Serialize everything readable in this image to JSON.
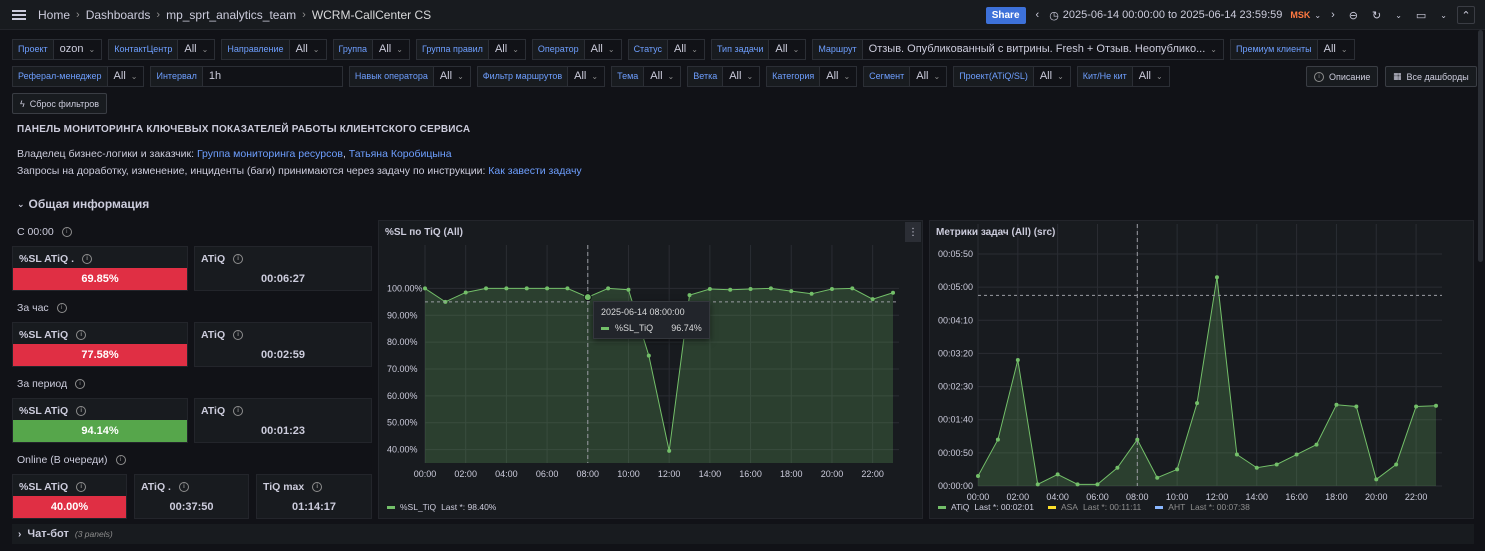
{
  "topbar": {
    "breadcrumb": [
      "Home",
      "Dashboards",
      "mp_sprt_analytics_team",
      "WCRM-CallCenter CS"
    ],
    "share_label": "Share",
    "time_range": "2025-06-14 00:00:00 to 2025-06-14 23:59:59",
    "timezone": "MSK"
  },
  "variables": {
    "row1": [
      {
        "label": "Проект",
        "value": "ozon"
      },
      {
        "label": "КонтактЦентр",
        "value": "All"
      },
      {
        "label": "Направление",
        "value": "All"
      },
      {
        "label": "Группа",
        "value": "All"
      },
      {
        "label": "Группа правил",
        "value": "All"
      },
      {
        "label": "Оператор",
        "value": "All"
      },
      {
        "label": "Статус",
        "value": "All"
      },
      {
        "label": "Тип задачи",
        "value": "All"
      },
      {
        "label": "Маршрут",
        "value": "Отзыв. Опубликованный с витрины. Fresh + Отзыв. Неопублико..."
      },
      {
        "label": "Премиум клиенты",
        "value": "All"
      }
    ],
    "row2": [
      {
        "label": "Реферал-менеджер",
        "value": "All"
      },
      {
        "label": "Интервал",
        "value": "1h"
      },
      {
        "label": "Навык оператора",
        "value": "All"
      },
      {
        "label": "Фильтр маршрутов",
        "value": "All"
      },
      {
        "label": "Тема",
        "value": "All"
      },
      {
        "label": "Ветка",
        "value": "All"
      },
      {
        "label": "Категория",
        "value": "All"
      },
      {
        "label": "Сегмент",
        "value": "All"
      },
      {
        "label": "Проект(ATiQ/SL)",
        "value": "All"
      },
      {
        "label": "Кит/Не кит",
        "value": "All"
      }
    ],
    "description_button": "Описание",
    "all_dashboards_button": "Все дашборды",
    "reset_button": "Сброс фильтров"
  },
  "text": {
    "heading": "ПАНЕЛЬ МОНИТОРИНГА КЛЮЧЕВЫХ ПОКАЗАТЕЛЕЙ РАБОТЫ КЛИЕНТСКОГО СЕРВИСА",
    "owner_prefix": "Владелец бизнес-логики и заказчик:",
    "owner_link1": "Группа мониторинга ресурсов",
    "owner_comma": ",",
    "owner_link2": "Татьяна Коробицына",
    "requests_prefix": "Запросы на доработку, изменение, инциденты (баги) принимаются через задачу по инструкции:",
    "requests_link": "Как завести задачу"
  },
  "section_general": "Общая информация",
  "groups": {
    "g1": {
      "title": "С 00:00",
      "sl_label": "%SL ATiQ .",
      "sl_value": "69.85%",
      "atiq_label": "ATiQ",
      "atiq_value": "00:06:27"
    },
    "g2": {
      "title": "За час",
      "sl_label": "%SL ATiQ",
      "sl_value": "77.58%",
      "atiq_label": "ATiQ",
      "atiq_value": "00:02:59"
    },
    "g3": {
      "title": "За период",
      "sl_label": "%SL ATiQ",
      "sl_value": "94.14%",
      "atiq_label": "ATiQ",
      "atiq_value": "00:01:23"
    },
    "g4": {
      "title": "Online (В очереди)",
      "sl_label": "%SL ATiQ",
      "sl_value": "40.00%",
      "atiq_label": "ATiQ .",
      "atiq_value": "00:37:50",
      "tiq_label": "TiQ max",
      "tiq_value": "01:14:17"
    }
  },
  "panel_sl": {
    "title": "%SL по TiQ (All)",
    "tooltip_time": "2025-06-14 08:00:00",
    "tooltip_series": "%SL_TiQ",
    "tooltip_value": "96.74%",
    "legend_name": "%SL_TiQ",
    "legend_last": "Last *: 98.40%"
  },
  "panel_tasks": {
    "title": "Метрики задач (All) (src)",
    "legend": [
      {
        "name": "ATiQ",
        "last": "Last *: 00:02:01",
        "color": "#73bf69"
      },
      {
        "name": "ASA",
        "last": "Last *: 00:11:11",
        "color": "#fade2a"
      },
      {
        "name": "AHT",
        "last": "Last *: 00:07:38",
        "color": "#8ab8ff"
      }
    ]
  },
  "collapsed_row": {
    "title": "Чат-бот",
    "count": "(3 panels)"
  },
  "colors": {
    "red": "#e02f44",
    "green": "#56a64b",
    "accent": "#6e9fff",
    "series": "#73bf69"
  },
  "chart_data": [
    {
      "type": "area",
      "title": "%SL по TiQ (All)",
      "x": [
        "00:00",
        "01:00",
        "02:00",
        "03:00",
        "04:00",
        "05:00",
        "06:00",
        "07:00",
        "08:00",
        "09:00",
        "10:00",
        "11:00",
        "12:00",
        "13:00",
        "14:00",
        "15:00",
        "16:00",
        "17:00",
        "18:00",
        "19:00",
        "20:00",
        "21:00",
        "22:00",
        "23:00"
      ],
      "series": [
        {
          "name": "%SL_TiQ",
          "values": [
            100,
            95,
            98.5,
            100,
            100,
            100,
            100,
            100,
            96.74,
            100,
            99.5,
            75,
            39.5,
            97.5,
            99.8,
            99.5,
            99.8,
            100,
            99,
            98,
            99.8,
            100,
            96,
            98.4
          ]
        }
      ],
      "threshold": 95,
      "ylim": [
        35,
        105
      ],
      "yticks": [
        40,
        50,
        60,
        70,
        80,
        90,
        100
      ],
      "xticks": [
        "00:00",
        "02:00",
        "04:00",
        "06:00",
        "08:00",
        "10:00",
        "12:00",
        "14:00",
        "16:00",
        "18:00",
        "20:00",
        "22:00"
      ],
      "ytick_suffix": "%"
    },
    {
      "type": "area",
      "title": "Метрики задач (All) (src)",
      "x": [
        "00:00",
        "01:00",
        "02:00",
        "03:00",
        "04:00",
        "05:00",
        "06:00",
        "07:00",
        "08:00",
        "09:00",
        "10:00",
        "11:00",
        "12:00",
        "13:00",
        "14:00",
        "15:00",
        "16:00",
        "17:00",
        "18:00",
        "19:00",
        "20:00",
        "21:00",
        "22:00",
        "23:00"
      ],
      "series": [
        {
          "name": "ATiQ",
          "values": [
            30,
            140,
            380,
            5,
            35,
            5,
            5,
            55,
            140,
            25,
            50,
            250,
            630,
            95,
            55,
            65,
            95,
            125,
            245,
            240,
            20,
            65,
            240,
            242
          ]
        }
      ],
      "threshold": 575,
      "ylim": [
        0,
        700
      ],
      "yticks": [
        "00:00:00",
        "00:00:50",
        "00:01:40",
        "00:02:30",
        "00:03:20",
        "00:04:10",
        "00:05:00",
        "00:05:50"
      ],
      "xticks": [
        "00:00",
        "02:00",
        "04:00",
        "06:00",
        "08:00",
        "10:00",
        "12:00",
        "14:00",
        "16:00",
        "18:00",
        "20:00",
        "22:00"
      ]
    }
  ]
}
